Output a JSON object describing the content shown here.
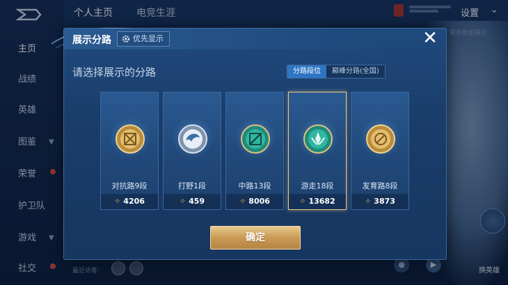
{
  "sidebar": {
    "items": [
      {
        "label": "主页",
        "active": true
      },
      {
        "label": "战绩"
      },
      {
        "label": "英雄"
      },
      {
        "label": "图鉴"
      },
      {
        "label": "荣誉"
      },
      {
        "label": "护卫队"
      },
      {
        "label": "游戏"
      },
      {
        "label": "社交"
      }
    ]
  },
  "topbar": {
    "tabs": [
      "个人主页",
      "电竞生涯"
    ],
    "settings": "设置"
  },
  "background": {
    "data_hint": "荣和数据展示",
    "recent": "最近访客:",
    "change_hero": "换英雄"
  },
  "modal": {
    "title": "展示分路",
    "priority_button": "优先显示",
    "close_icon": "close-icon",
    "prompt": "请选择展示的分路",
    "segments": [
      {
        "label": "分路段位",
        "active": true
      },
      {
        "label": "巅峰分路(全国)",
        "active": false
      }
    ],
    "cards": [
      {
        "name": "对抗路9段",
        "score": "4206",
        "selected": false,
        "medal": "gold"
      },
      {
        "name": "打野1段",
        "score": "459",
        "selected": false,
        "medal": "silver"
      },
      {
        "name": "中路13段",
        "score": "8006",
        "selected": false,
        "medal": "emerald"
      },
      {
        "name": "游走18段",
        "score": "13682",
        "selected": true,
        "medal": "emerald"
      },
      {
        "name": "发育路8段",
        "score": "3873",
        "selected": false,
        "medal": "gold"
      }
    ],
    "confirm": "确定"
  },
  "colors": {
    "accent_gold": "#c99b55",
    "segment_active": "#2f75c4",
    "selected_border": "#e9c98a"
  }
}
